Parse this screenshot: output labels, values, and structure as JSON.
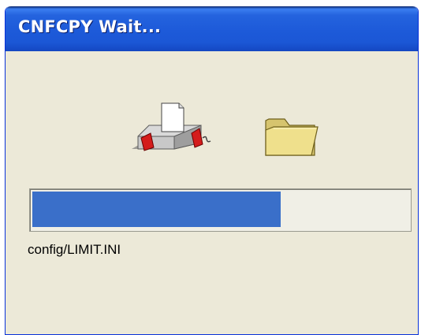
{
  "window": {
    "title": "CNFCPY Wait..."
  },
  "icons": {
    "source": "printer-icon",
    "destination": "folder-icon"
  },
  "progress": {
    "fraction": 0.66,
    "color": "#3a6fc9"
  },
  "status": {
    "current_file": "config/LIMIT.INI"
  },
  "colors": {
    "titlebar": "#2463de",
    "background": "#ece9d8"
  }
}
